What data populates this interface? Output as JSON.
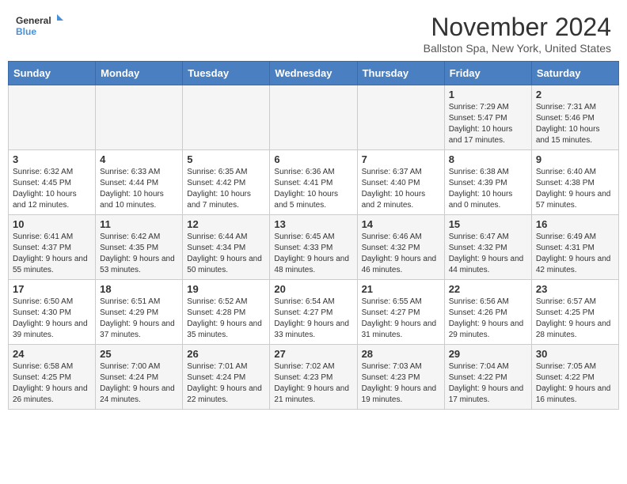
{
  "logo": {
    "line1": "General",
    "line2": "Blue"
  },
  "title": "November 2024",
  "location": "Ballston Spa, New York, United States",
  "days_of_week": [
    "Sunday",
    "Monday",
    "Tuesday",
    "Wednesday",
    "Thursday",
    "Friday",
    "Saturday"
  ],
  "weeks": [
    [
      {
        "day": "",
        "info": ""
      },
      {
        "day": "",
        "info": ""
      },
      {
        "day": "",
        "info": ""
      },
      {
        "day": "",
        "info": ""
      },
      {
        "day": "",
        "info": ""
      },
      {
        "day": "1",
        "info": "Sunrise: 7:29 AM\nSunset: 5:47 PM\nDaylight: 10 hours and 17 minutes."
      },
      {
        "day": "2",
        "info": "Sunrise: 7:31 AM\nSunset: 5:46 PM\nDaylight: 10 hours and 15 minutes."
      }
    ],
    [
      {
        "day": "3",
        "info": "Sunrise: 6:32 AM\nSunset: 4:45 PM\nDaylight: 10 hours and 12 minutes."
      },
      {
        "day": "4",
        "info": "Sunrise: 6:33 AM\nSunset: 4:44 PM\nDaylight: 10 hours and 10 minutes."
      },
      {
        "day": "5",
        "info": "Sunrise: 6:35 AM\nSunset: 4:42 PM\nDaylight: 10 hours and 7 minutes."
      },
      {
        "day": "6",
        "info": "Sunrise: 6:36 AM\nSunset: 4:41 PM\nDaylight: 10 hours and 5 minutes."
      },
      {
        "day": "7",
        "info": "Sunrise: 6:37 AM\nSunset: 4:40 PM\nDaylight: 10 hours and 2 minutes."
      },
      {
        "day": "8",
        "info": "Sunrise: 6:38 AM\nSunset: 4:39 PM\nDaylight: 10 hours and 0 minutes."
      },
      {
        "day": "9",
        "info": "Sunrise: 6:40 AM\nSunset: 4:38 PM\nDaylight: 9 hours and 57 minutes."
      }
    ],
    [
      {
        "day": "10",
        "info": "Sunrise: 6:41 AM\nSunset: 4:37 PM\nDaylight: 9 hours and 55 minutes."
      },
      {
        "day": "11",
        "info": "Sunrise: 6:42 AM\nSunset: 4:35 PM\nDaylight: 9 hours and 53 minutes."
      },
      {
        "day": "12",
        "info": "Sunrise: 6:44 AM\nSunset: 4:34 PM\nDaylight: 9 hours and 50 minutes."
      },
      {
        "day": "13",
        "info": "Sunrise: 6:45 AM\nSunset: 4:33 PM\nDaylight: 9 hours and 48 minutes."
      },
      {
        "day": "14",
        "info": "Sunrise: 6:46 AM\nSunset: 4:32 PM\nDaylight: 9 hours and 46 minutes."
      },
      {
        "day": "15",
        "info": "Sunrise: 6:47 AM\nSunset: 4:32 PM\nDaylight: 9 hours and 44 minutes."
      },
      {
        "day": "16",
        "info": "Sunrise: 6:49 AM\nSunset: 4:31 PM\nDaylight: 9 hours and 42 minutes."
      }
    ],
    [
      {
        "day": "17",
        "info": "Sunrise: 6:50 AM\nSunset: 4:30 PM\nDaylight: 9 hours and 39 minutes."
      },
      {
        "day": "18",
        "info": "Sunrise: 6:51 AM\nSunset: 4:29 PM\nDaylight: 9 hours and 37 minutes."
      },
      {
        "day": "19",
        "info": "Sunrise: 6:52 AM\nSunset: 4:28 PM\nDaylight: 9 hours and 35 minutes."
      },
      {
        "day": "20",
        "info": "Sunrise: 6:54 AM\nSunset: 4:27 PM\nDaylight: 9 hours and 33 minutes."
      },
      {
        "day": "21",
        "info": "Sunrise: 6:55 AM\nSunset: 4:27 PM\nDaylight: 9 hours and 31 minutes."
      },
      {
        "day": "22",
        "info": "Sunrise: 6:56 AM\nSunset: 4:26 PM\nDaylight: 9 hours and 29 minutes."
      },
      {
        "day": "23",
        "info": "Sunrise: 6:57 AM\nSunset: 4:25 PM\nDaylight: 9 hours and 28 minutes."
      }
    ],
    [
      {
        "day": "24",
        "info": "Sunrise: 6:58 AM\nSunset: 4:25 PM\nDaylight: 9 hours and 26 minutes."
      },
      {
        "day": "25",
        "info": "Sunrise: 7:00 AM\nSunset: 4:24 PM\nDaylight: 9 hours and 24 minutes."
      },
      {
        "day": "26",
        "info": "Sunrise: 7:01 AM\nSunset: 4:24 PM\nDaylight: 9 hours and 22 minutes."
      },
      {
        "day": "27",
        "info": "Sunrise: 7:02 AM\nSunset: 4:23 PM\nDaylight: 9 hours and 21 minutes."
      },
      {
        "day": "28",
        "info": "Sunrise: 7:03 AM\nSunset: 4:23 PM\nDaylight: 9 hours and 19 minutes."
      },
      {
        "day": "29",
        "info": "Sunrise: 7:04 AM\nSunset: 4:22 PM\nDaylight: 9 hours and 17 minutes."
      },
      {
        "day": "30",
        "info": "Sunrise: 7:05 AM\nSunset: 4:22 PM\nDaylight: 9 hours and 16 minutes."
      }
    ]
  ]
}
